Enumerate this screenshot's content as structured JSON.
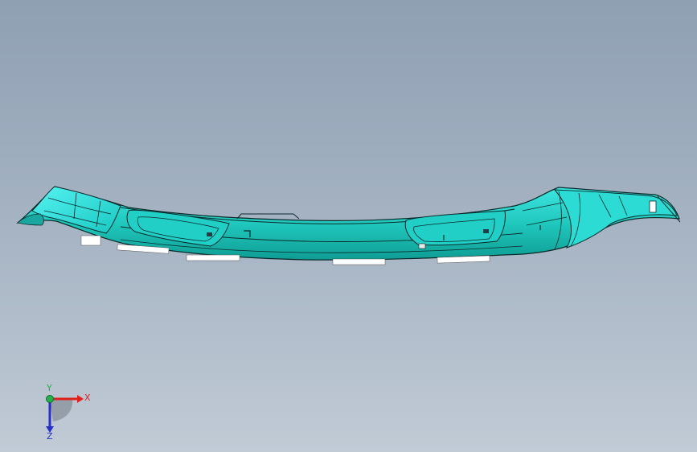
{
  "viewport": {
    "background_top": "#8fa0b3",
    "background_bottom": "#c1cbd6"
  },
  "model": {
    "icon": "trim-panel-3d-model",
    "surface_color": "#1fd1c6",
    "highlight_color": "#3fe8e6",
    "edge_color": "#0a2a2a"
  },
  "triad": {
    "icon": "coordinate-triad-icon",
    "x_label": "X",
    "y_label": "Y",
    "z_label": "Z",
    "x_color": "#e0201c",
    "y_color": "#22b14c",
    "z_color": "#2430c8"
  }
}
